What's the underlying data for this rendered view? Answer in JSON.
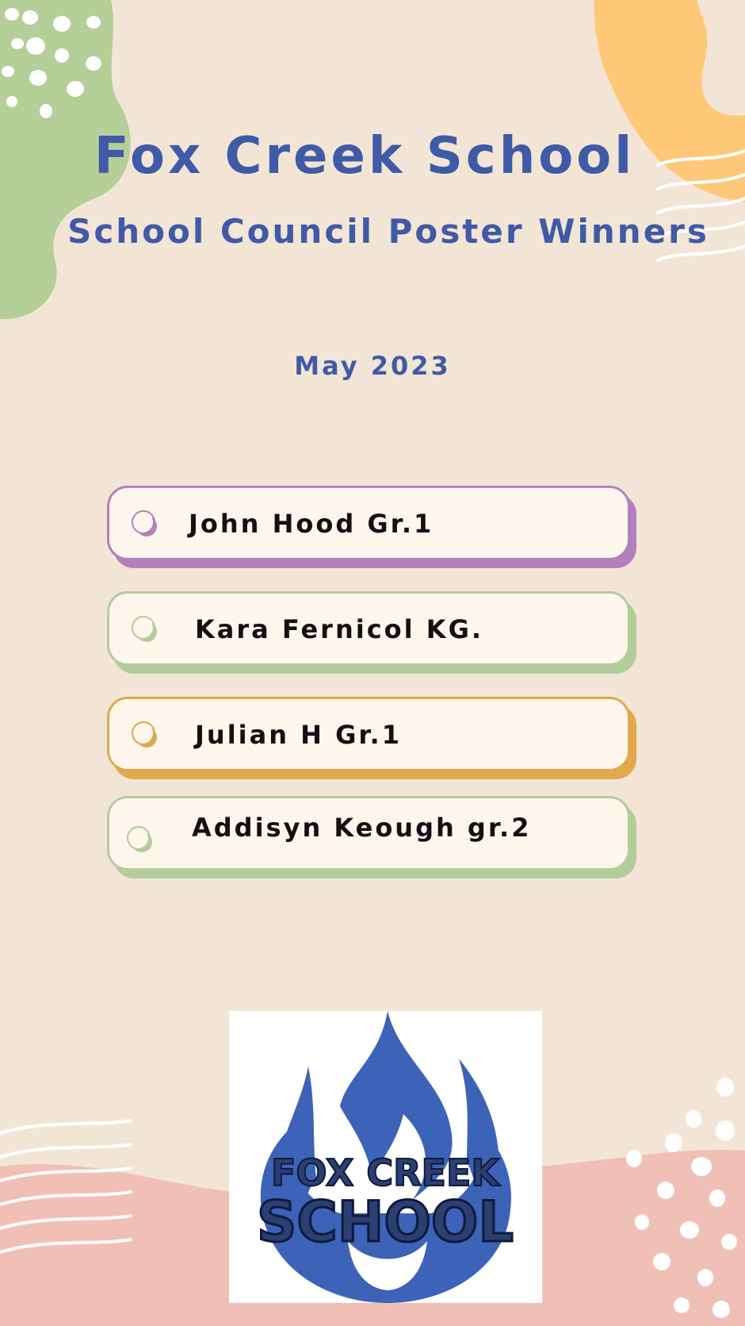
{
  "header": {
    "school": "Fox Creek School",
    "subtitle": "School Council Poster Winners",
    "date": "May 2023"
  },
  "winners": [
    {
      "name": "John Hood Gr.1",
      "color": "#b47fbd"
    },
    {
      "name": "Kara Fernicol KG.",
      "color": "#b2cd9a"
    },
    {
      "name": "Julian H Gr.1",
      "color": "#e2a84e"
    },
    {
      "name": "Addisyn Keough gr.2",
      "color": "#b2cd9a"
    }
  ],
  "logo": {
    "line1": "FOX CREEK",
    "line2": "SCHOOL",
    "icon": "flame-icon",
    "color": "#3c63b8"
  },
  "palette": {
    "background": "#f3e5d5",
    "green_blob": "#b4cf98",
    "orange_blob": "#fec878",
    "pink_wave": "#f0c0b6",
    "title": "#3f5aa6"
  }
}
